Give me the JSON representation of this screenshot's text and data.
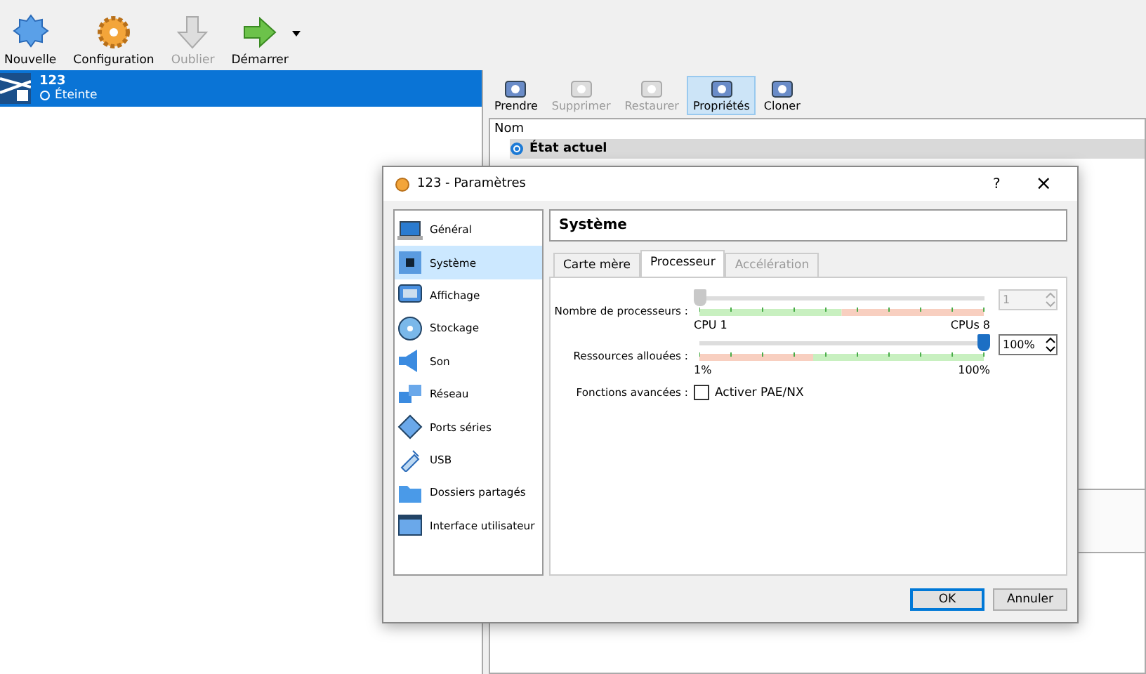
{
  "main_toolbar": [
    {
      "label": "Nouvelle",
      "disabled": false,
      "dropdown": false
    },
    {
      "label": "Configuration",
      "disabled": false,
      "dropdown": false
    },
    {
      "label": "Oublier",
      "disabled": true,
      "dropdown": false
    },
    {
      "label": "Démarrer",
      "disabled": false,
      "dropdown": true
    }
  ],
  "vm_list": [
    {
      "name": "123",
      "state": "Éteinte",
      "selected": true
    }
  ],
  "snapshot_toolbar": [
    {
      "label": "Prendre",
      "disabled": false,
      "pressed": false
    },
    {
      "label": "Supprimer",
      "disabled": true,
      "pressed": false
    },
    {
      "label": "Restaurer",
      "disabled": true,
      "pressed": false
    },
    {
      "label": "Propriétés",
      "disabled": false,
      "pressed": true
    },
    {
      "label": "Cloner",
      "disabled": false,
      "pressed": false
    }
  ],
  "snapshot_table": {
    "column": "Nom",
    "rows": [
      {
        "name": "État actuel",
        "selected": true
      }
    ]
  },
  "dialog": {
    "title": "123 - Paramètres",
    "help": "?",
    "close": "×",
    "sidebar": [
      {
        "label": "Général",
        "selected": false
      },
      {
        "label": "Système",
        "selected": true
      },
      {
        "label": "Affichage",
        "selected": false
      },
      {
        "label": "Stockage",
        "selected": false
      },
      {
        "label": "Son",
        "selected": false
      },
      {
        "label": "Réseau",
        "selected": false
      },
      {
        "label": "Ports séries",
        "selected": false
      },
      {
        "label": "USB",
        "selected": false
      },
      {
        "label": "Dossiers partagés",
        "selected": false
      },
      {
        "label": "Interface utilisateur",
        "selected": false
      }
    ],
    "heading": "Système",
    "tabs": [
      {
        "label": "Carte mère",
        "selected": false,
        "disabled": false
      },
      {
        "label": "Processeur",
        "selected": true,
        "disabled": false
      },
      {
        "label": "Accélération",
        "selected": false,
        "disabled": true
      }
    ],
    "sliders": [
      {
        "label": "Nombre de processeurs :",
        "level": 0,
        "value": "1",
        "disabled": true,
        "min_label": "CPU 1",
        "max_label": "CPUs 8"
      },
      {
        "label": "Ressources allouées :",
        "level": 1,
        "value": "100%",
        "disabled": false,
        "min_label": "1%",
        "max_label": "100%"
      }
    ],
    "advanced": {
      "label": "Fonctions avancées :",
      "checkbox": "Activer PAE/NX",
      "checked": false
    },
    "buttons": [
      {
        "label": "OK",
        "default": true
      },
      {
        "label": "Annuler",
        "default": false
      }
    ]
  }
}
